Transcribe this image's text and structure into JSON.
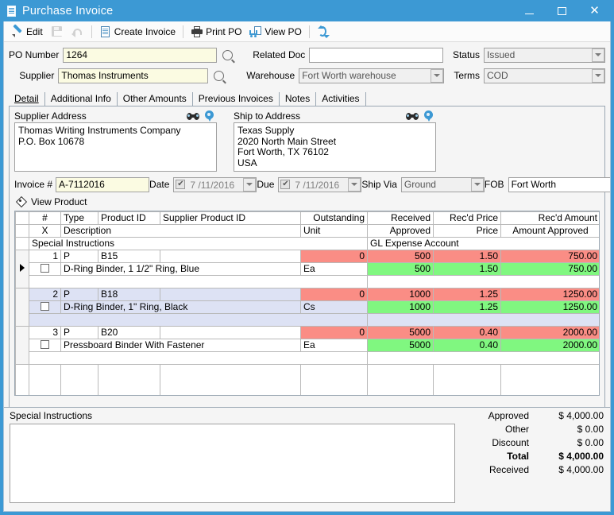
{
  "window": {
    "title": "Purchase Invoice",
    "icon": "document-icon",
    "minimize": "–",
    "maximize": "□",
    "close": "✕"
  },
  "toolbar": {
    "items": [
      {
        "name": "edit",
        "label": "Edit",
        "icon": "pencil-icon",
        "disabled": false
      },
      {
        "name": "save",
        "label": "",
        "icon": "floppy-disk-icon",
        "disabled": true
      },
      {
        "name": "undo",
        "label": "",
        "icon": "undo-arrow-icon",
        "disabled": true
      },
      {
        "name": "create-invoice",
        "label": "Create Invoice",
        "icon": "document-icon",
        "disabled": false
      },
      {
        "name": "print-po",
        "label": "Print PO",
        "icon": "printer-icon",
        "disabled": false
      },
      {
        "name": "view-po",
        "label": "View PO",
        "icon": "view-po-icon",
        "disabled": false
      },
      {
        "name": "refresh",
        "label": "",
        "icon": "refresh-icon",
        "disabled": false
      }
    ]
  },
  "header": {
    "po_number_label": "PO Number",
    "po_number_value": "1264",
    "supplier_label": "Supplier",
    "supplier_value": "Thomas Instruments",
    "related_doc_label": "Related Doc",
    "related_doc_value": "",
    "warehouse_label": "Warehouse",
    "warehouse_value": "Fort Worth warehouse",
    "status_label": "Status",
    "status_value": "Issued",
    "terms_label": "Terms",
    "terms_value": "COD"
  },
  "tabs": [
    {
      "label": "Detail",
      "active": true
    },
    {
      "label": "Additional Info",
      "active": false
    },
    {
      "label": "Other Amounts",
      "active": false
    },
    {
      "label": "Previous Invoices",
      "active": false
    },
    {
      "label": "Notes",
      "active": false
    },
    {
      "label": "Activities",
      "active": false
    }
  ],
  "addresses": {
    "supplier_title": "Supplier Address",
    "supplier_text": "Thomas Writing Instruments Company\nP.O. Box 10678",
    "ship_title": "Ship to Address",
    "ship_text": "Texas Supply\n2020 North Main Street\nFort Worth, TX 76102\nUSA"
  },
  "invoice_row": {
    "invoice_label": "Invoice #",
    "invoice_value": "A-7112016",
    "date_label": "Date",
    "date_value": "7 /11/2016",
    "date_checked": true,
    "due_label": "Due",
    "due_value": "7 /11/2016",
    "due_checked": true,
    "ship_via_label": "Ship Via",
    "ship_via_value": "Ground",
    "fob_label": "FOB",
    "fob_value": "Fort Worth"
  },
  "view_product": {
    "label": "View Product",
    "icon": "tag-icon"
  },
  "grid": {
    "header_row1": [
      "#",
      "Type",
      "Product ID",
      "Supplier Product ID",
      "Outstanding",
      "Received",
      "Rec'd Price",
      "Rec'd Amount"
    ],
    "header_row2": [
      "X",
      "Description",
      "Unit",
      "Approved",
      "Price",
      "Amount Approved"
    ],
    "header_row3": [
      "Special Instructions",
      "GL Expense Account"
    ],
    "rows": [
      {
        "selected": true,
        "highlighted": false,
        "num": "1",
        "type": "P",
        "product_id": "B15",
        "supplier_product_id": "",
        "outstanding": "0",
        "received": "500",
        "recd_price": "1.50",
        "recd_amount": "750.00",
        "checked": false,
        "description": "D-Ring Binder, 1 1/2\" Ring, Blue",
        "unit": "Ea",
        "approved": "500",
        "price": "1.50",
        "amount_approved": "750.00",
        "special_instructions": "",
        "gl_expense_account": ""
      },
      {
        "selected": false,
        "highlighted": true,
        "num": "2",
        "type": "P",
        "product_id": "B18",
        "supplier_product_id": "",
        "outstanding": "0",
        "received": "1000",
        "recd_price": "1.25",
        "recd_amount": "1250.00",
        "checked": false,
        "description": "D-Ring Binder, 1\" Ring, Black",
        "unit": "Cs",
        "approved": "1000",
        "price": "1.25",
        "amount_approved": "1250.00",
        "special_instructions": "",
        "gl_expense_account": ""
      },
      {
        "selected": false,
        "highlighted": false,
        "num": "3",
        "type": "P",
        "product_id": "B20",
        "supplier_product_id": "",
        "outstanding": "0",
        "received": "5000",
        "recd_price": "0.40",
        "recd_amount": "2000.00",
        "checked": false,
        "description": "Pressboard Binder With Fastener",
        "unit": "Ea",
        "approved": "5000",
        "price": "0.40",
        "amount_approved": "2000.00",
        "special_instructions": "",
        "gl_expense_account": ""
      }
    ]
  },
  "footer": {
    "special_instructions_label": "Special Instructions",
    "special_instructions_value": "",
    "totals": [
      {
        "label": "Approved",
        "value": "$ 4,000.00",
        "bold": false
      },
      {
        "label": "Other",
        "value": "$ 0.00",
        "bold": false
      },
      {
        "label": "Discount",
        "value": "$ 0.00",
        "bold": false
      },
      {
        "label": "Total",
        "value": "$ 4,000.00",
        "bold": true
      },
      {
        "label": "Received",
        "value": "$ 4,000.00",
        "bold": false
      }
    ]
  },
  "colors": {
    "titlebar": "#3c99d4",
    "received_header": "#fa8d85",
    "approved_header": "#80f780",
    "row_highlight": "#dde2f4",
    "field_yellow": "#fbfbe2"
  }
}
